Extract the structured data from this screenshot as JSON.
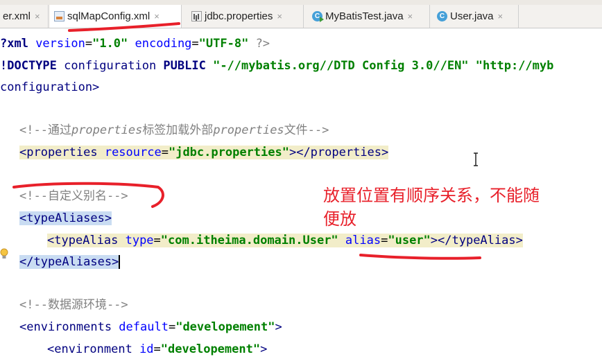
{
  "tabs": [
    {
      "label": "er.xml",
      "icon": "xml-file-icon",
      "active": false
    },
    {
      "label": "sqlMapConfig.xml",
      "icon": "xml-file-icon",
      "active": true
    },
    {
      "label": "jdbc.properties",
      "icon": "properties-file-icon",
      "active": false
    },
    {
      "label": "MyBatisTest.java",
      "icon": "java-class-icon",
      "active": false
    },
    {
      "label": "User.java",
      "icon": "java-class-icon",
      "active": false
    }
  ],
  "close_glyph": "×",
  "code": {
    "decl_a": "?xml ",
    "decl_b": "version",
    "decl_c": "=",
    "decl_d": "\"1.0\"",
    "decl_e": " ",
    "decl_f": "encoding",
    "decl_g": "=",
    "decl_h": "\"UTF-8\"",
    "decl_i": " ?>",
    "doctype_a": "!DOCTYPE ",
    "doctype_b": "configuration",
    "doctype_c": " PUBLIC ",
    "doctype_d": "\"-//mybatis.org//DTD Config 3.0//EN\"",
    "doctype_e": " \"http://myb",
    "config_open": "configuration>",
    "c1_a": "<!--通过",
    "c1_b": "properties",
    "c1_c": "标签加载外部",
    "c1_d": "properties",
    "c1_e": "文件-->",
    "props_a": "<properties ",
    "props_b": "resource",
    "props_c": "=",
    "props_d": "\"jdbc.properties\"",
    "props_e": "></properties>",
    "c2": "<!--自定义别名-->",
    "ta_open": "<typeAliases>",
    "alias_a": "<typeAlias ",
    "alias_b": "type",
    "alias_c": "=",
    "alias_d": "\"com.itheima.domain.User\"",
    "alias_e": " ",
    "alias_f": "alias",
    "alias_g": "=",
    "alias_h": "\"user\"",
    "alias_i": "></typeAlias>",
    "ta_close": "</typeAliases>",
    "c3": "<!--数据源环境-->",
    "env_a": "<environments ",
    "env_b": "default",
    "env_c": "=",
    "env_d": "\"developement\"",
    "env_e": ">",
    "env2_a": "<environment ",
    "env2_b": "id",
    "env2_c": "=",
    "env2_d": "\"developement\"",
    "env2_e": ">"
  },
  "annotation": {
    "line1": "放置位置有顺序关系，不能随",
    "line2": "便放"
  },
  "colors": {
    "annotation": "#e8202a",
    "tag": "#000080",
    "attr": "#0000ff",
    "value": "#008000",
    "comment": "#808080"
  }
}
